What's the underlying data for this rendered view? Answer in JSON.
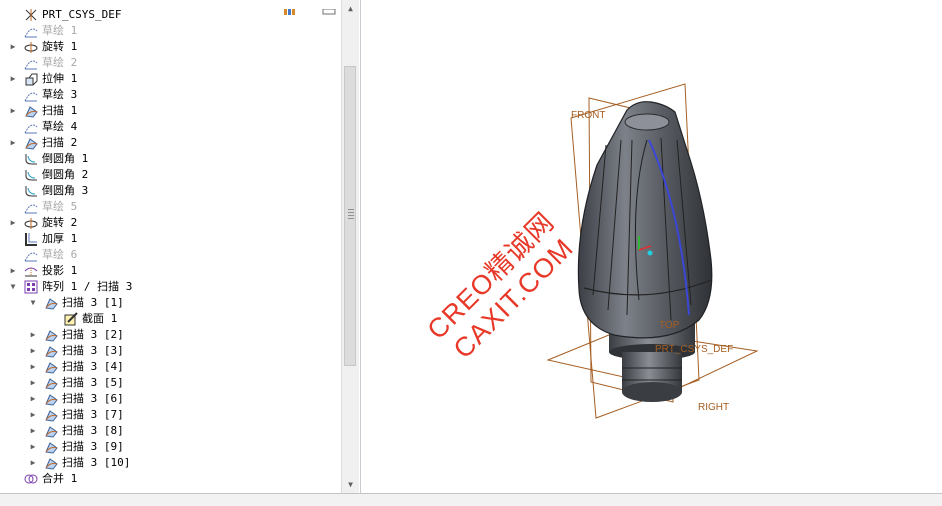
{
  "tree": {
    "items": [
      {
        "label": "PRT_CSYS_DEF",
        "icon": "csys-icon",
        "state": "normal",
        "expander": "none",
        "indent": 0
      },
      {
        "label": "草绘 1",
        "icon": "sketch-icon",
        "state": "suppressed",
        "expander": "none",
        "indent": 0
      },
      {
        "label": "旋转 1",
        "icon": "revolve-icon",
        "state": "normal",
        "expander": "collapsed",
        "indent": 0
      },
      {
        "label": "草绘 2",
        "icon": "sketch-icon",
        "state": "suppressed",
        "expander": "none",
        "indent": 0
      },
      {
        "label": "拉伸 1",
        "icon": "extrude-icon",
        "state": "normal",
        "expander": "collapsed",
        "indent": 0
      },
      {
        "label": "草绘 3",
        "icon": "sketch-icon",
        "state": "normal",
        "expander": "none",
        "indent": 0
      },
      {
        "label": "扫描 1",
        "icon": "sweep-icon",
        "state": "normal",
        "expander": "collapsed",
        "indent": 0
      },
      {
        "label": "草绘 4",
        "icon": "sketch-icon",
        "state": "normal",
        "expander": "none",
        "indent": 0
      },
      {
        "label": "扫描 2",
        "icon": "sweep-icon",
        "state": "normal",
        "expander": "collapsed",
        "indent": 0
      },
      {
        "label": "倒圆角 1",
        "icon": "round-icon",
        "state": "normal",
        "expander": "none",
        "indent": 0
      },
      {
        "label": "倒圆角 2",
        "icon": "round-icon",
        "state": "normal",
        "expander": "none",
        "indent": 0
      },
      {
        "label": "倒圆角 3",
        "icon": "round-icon",
        "state": "normal",
        "expander": "none",
        "indent": 0
      },
      {
        "label": "草绘 5",
        "icon": "sketch-icon",
        "state": "suppressed",
        "expander": "none",
        "indent": 0
      },
      {
        "label": "旋转 2",
        "icon": "revolve-icon",
        "state": "normal",
        "expander": "collapsed",
        "indent": 0
      },
      {
        "label": "加厚 1",
        "icon": "thicken-icon",
        "state": "normal",
        "expander": "none",
        "indent": 0
      },
      {
        "label": "草绘 6",
        "icon": "sketch-icon",
        "state": "suppressed",
        "expander": "none",
        "indent": 0
      },
      {
        "label": "投影 1",
        "icon": "project-icon",
        "state": "normal",
        "expander": "collapsed",
        "indent": 0
      },
      {
        "label": "阵列 1 / 扫描 3",
        "icon": "pattern-icon",
        "state": "normal",
        "expander": "expanded",
        "indent": 0
      },
      {
        "label": "扫描 3 [1]",
        "icon": "sweep-icon",
        "state": "normal",
        "expander": "expanded",
        "indent": 1
      },
      {
        "label": "截面 1",
        "icon": "section-icon",
        "state": "normal",
        "expander": "none",
        "indent": 2
      },
      {
        "label": "扫描 3 [2]",
        "icon": "sweep-icon",
        "state": "normal",
        "expander": "collapsed",
        "indent": 1
      },
      {
        "label": "扫描 3 [3]",
        "icon": "sweep-icon",
        "state": "normal",
        "expander": "collapsed",
        "indent": 1
      },
      {
        "label": "扫描 3 [4]",
        "icon": "sweep-icon",
        "state": "normal",
        "expander": "collapsed",
        "indent": 1
      },
      {
        "label": "扫描 3 [5]",
        "icon": "sweep-icon",
        "state": "normal",
        "expander": "collapsed",
        "indent": 1
      },
      {
        "label": "扫描 3 [6]",
        "icon": "sweep-icon",
        "state": "normal",
        "expander": "collapsed",
        "indent": 1
      },
      {
        "label": "扫描 3 [7]",
        "icon": "sweep-icon",
        "state": "normal",
        "expander": "collapsed",
        "indent": 1
      },
      {
        "label": "扫描 3 [8]",
        "icon": "sweep-icon",
        "state": "normal",
        "expander": "collapsed",
        "indent": 1
      },
      {
        "label": "扫描 3 [9]",
        "icon": "sweep-icon",
        "state": "normal",
        "expander": "collapsed",
        "indent": 1
      },
      {
        "label": "扫描 3 [10]",
        "icon": "sweep-icon",
        "state": "normal",
        "expander": "collapsed",
        "indent": 1
      },
      {
        "label": "合并 1",
        "icon": "merge-icon",
        "state": "normal",
        "expander": "none",
        "indent": 0
      }
    ]
  },
  "scrollbar": {
    "up_icon": "arrow-up-icon",
    "down_icon": "arrow-down-icon"
  },
  "graphics": {
    "datum_labels": {
      "front": "FRONT",
      "top": "TOP",
      "right": "RIGHT",
      "csys": "PRT_CSYS_DEF"
    },
    "watermark": "CREO精诚网CAXIT.COM"
  },
  "colors": {
    "datum_plane": "#a55e22",
    "model_body": "#5b5e64",
    "watermark": "#e83828",
    "sweep_highlight": "#3b47d6"
  }
}
